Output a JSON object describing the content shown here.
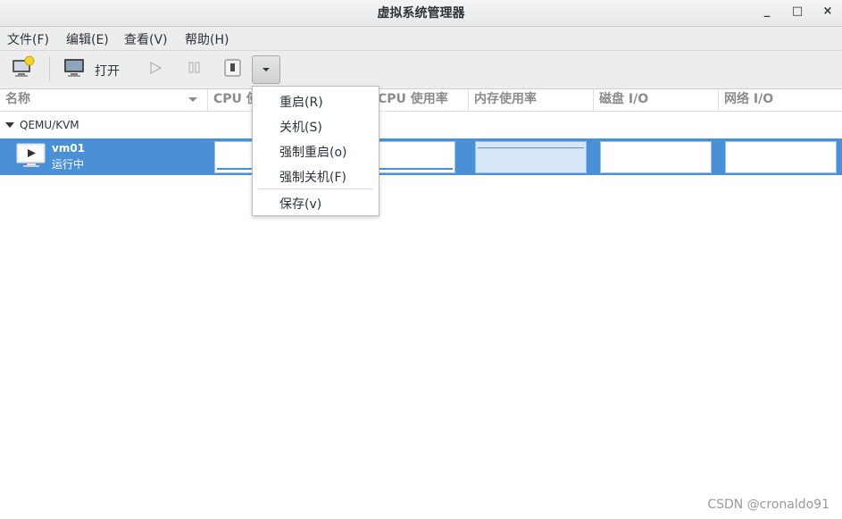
{
  "window": {
    "title": "虚拟系统管理器",
    "minimize": "_",
    "maximize": "□",
    "close": "×"
  },
  "menubar": {
    "items": [
      {
        "label": "文件(F)"
      },
      {
        "label": "编辑(E)"
      },
      {
        "label": "查看(V)"
      },
      {
        "label": "帮助(H)"
      }
    ]
  },
  "toolbar": {
    "open_label": "打开"
  },
  "columns": {
    "name": "名称",
    "cpu": "CPU 使",
    "host_cpu": "CPU 使用率",
    "memory": "内存使用率",
    "disk": "磁盘 I/O",
    "network": "网络 I/O"
  },
  "connection": {
    "label": "QEMU/KVM"
  },
  "vm": {
    "name": "vm01",
    "status": "运行中"
  },
  "shutdown_menu": {
    "items": [
      {
        "label": "重启(R)"
      },
      {
        "label": "关机(S)"
      },
      {
        "label": "强制重启(o)"
      },
      {
        "label": "强制关机(F)"
      },
      {
        "label": "保存(v)"
      }
    ]
  },
  "watermark": "CSDN @cronaldo91",
  "colors": {
    "selection": "#4a90d9",
    "background": "#ffffff",
    "chrome": "#ededed"
  }
}
